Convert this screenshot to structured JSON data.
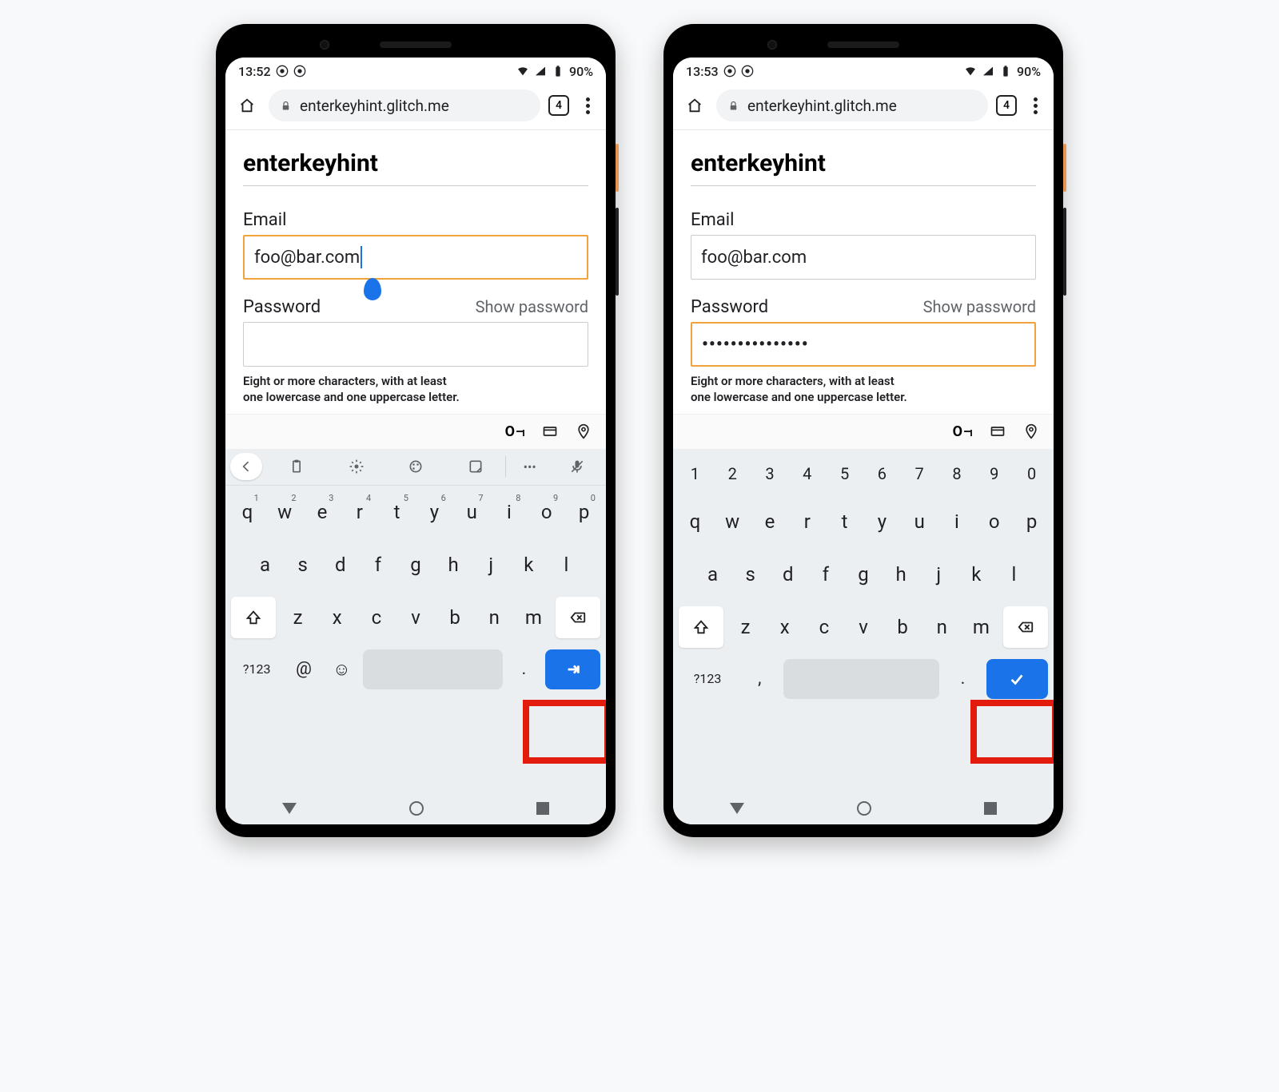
{
  "phones": [
    {
      "status": {
        "time": "13:52",
        "battery": "90%"
      },
      "omnibox": {
        "url": "enterkeyhint.glitch.me",
        "tab_count": "4"
      },
      "page": {
        "title": "enterkeyhint",
        "email_label": "Email",
        "email_value": "foo@bar.com",
        "password_label": "Password",
        "show_password": "Show password",
        "password_value": "",
        "hint": "Eight or more characters, with at least\none lowercase and one uppercase letter."
      },
      "keyboard": {
        "mode": "email",
        "num_row": null,
        "row1": [
          "q",
          "w",
          "e",
          "r",
          "t",
          "y",
          "u",
          "i",
          "o",
          "p"
        ],
        "row1_sup": [
          "1",
          "2",
          "3",
          "4",
          "5",
          "6",
          "7",
          "8",
          "9",
          "0"
        ],
        "row2": [
          "a",
          "s",
          "d",
          "f",
          "g",
          "h",
          "j",
          "k",
          "l"
        ],
        "row3": [
          "z",
          "x",
          "c",
          "v",
          "b",
          "n",
          "m"
        ],
        "bottom": {
          "sym": "?123",
          "left1": "@",
          "left2": "☺",
          "punct": ".",
          "enter": "next"
        }
      }
    },
    {
      "status": {
        "time": "13:53",
        "battery": "90%"
      },
      "omnibox": {
        "url": "enterkeyhint.glitch.me",
        "tab_count": "4"
      },
      "page": {
        "title": "enterkeyhint",
        "email_label": "Email",
        "email_value": "foo@bar.com",
        "password_label": "Password",
        "show_password": "Show password",
        "password_value": "•••••••••••••••",
        "hint": "Eight or more characters, with at least\none lowercase and one uppercase letter."
      },
      "keyboard": {
        "mode": "password",
        "num_row": [
          "1",
          "2",
          "3",
          "4",
          "5",
          "6",
          "7",
          "8",
          "9",
          "0"
        ],
        "row1": [
          "q",
          "w",
          "e",
          "r",
          "t",
          "y",
          "u",
          "i",
          "o",
          "p"
        ],
        "row1_sup": null,
        "row2": [
          "a",
          "s",
          "d",
          "f",
          "g",
          "h",
          "j",
          "k",
          "l"
        ],
        "row3": [
          "z",
          "x",
          "c",
          "v",
          "b",
          "n",
          "m"
        ],
        "bottom": {
          "sym": "?123",
          "left1": ",",
          "left2": null,
          "punct": ".",
          "enter": "done"
        }
      }
    }
  ]
}
